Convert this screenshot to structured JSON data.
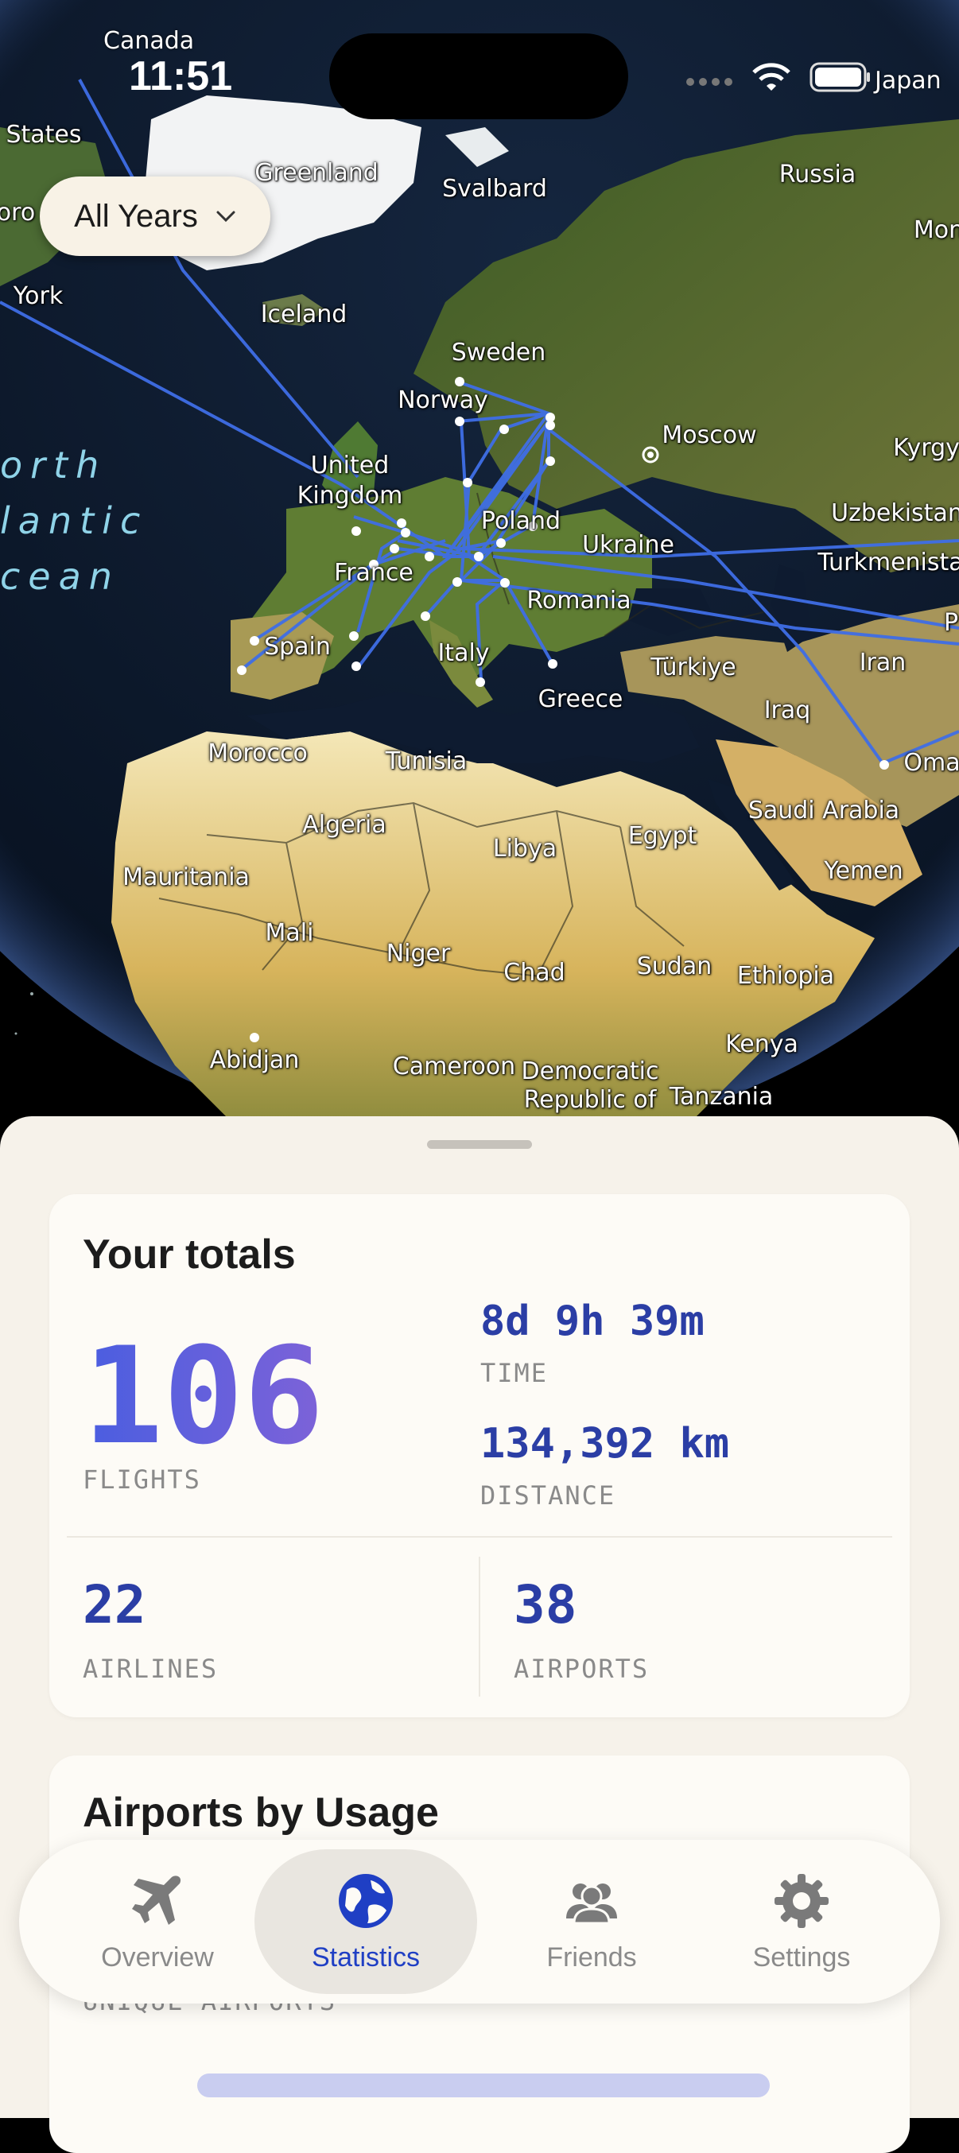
{
  "status_bar": {
    "time": "11:51",
    "carrier_left": "Canada",
    "carrier_right": "Japan"
  },
  "filter": {
    "label": "All Years"
  },
  "map": {
    "labels": [
      "States",
      "Greenland",
      "Svalbard",
      "Russia",
      "Mong",
      "York",
      "Iceland",
      "Sweden",
      "Norway",
      "Moscow",
      "Kyrgy",
      "United",
      "Kingdom",
      "Poland",
      "Uzbekistan",
      "Ukraine",
      "Turkmenista",
      "France",
      "Romania",
      "P",
      "Spain",
      "Italy",
      "Türkiye",
      "Iran",
      "Iraq",
      "Greece",
      "Morocco",
      "Tunisia",
      "Oma",
      "Saudi Arabia",
      "Algeria",
      "Libya",
      "Egypt",
      "Yemen",
      "Mauritania",
      "Mali",
      "Niger",
      "Chad",
      "Sudan",
      "Ethiopia",
      "Kenya",
      "Abidjan",
      "Cameroon",
      "Democratic",
      "Republic of",
      "Tanzania",
      "oro"
    ],
    "ocean_lines": [
      "orth",
      "lantic",
      "cean"
    ]
  },
  "totals": {
    "title": "Your totals",
    "flights": "106",
    "flights_label": "FLIGHTS",
    "time": "8d 9h 39m",
    "time_label": "TIME",
    "distance": "134,392 km",
    "distance_label": "DISTANCE",
    "airlines": "22",
    "airlines_label": "AIRLINES",
    "airports": "38",
    "airports_label": "AIRPORTS"
  },
  "usage": {
    "title": "Airports by Usage",
    "caption": "UNIQUE AIRPORTS"
  },
  "tabs": [
    {
      "label": "Overview",
      "icon": "airplane-icon"
    },
    {
      "label": "Statistics",
      "icon": "globe-icon",
      "active": true
    },
    {
      "label": "Friends",
      "icon": "people-icon"
    },
    {
      "label": "Settings",
      "icon": "gear-icon"
    }
  ],
  "colors": {
    "route": "#3f6ee6",
    "accent": "#2b3ea5",
    "active_tab": "#1f3fc4"
  }
}
